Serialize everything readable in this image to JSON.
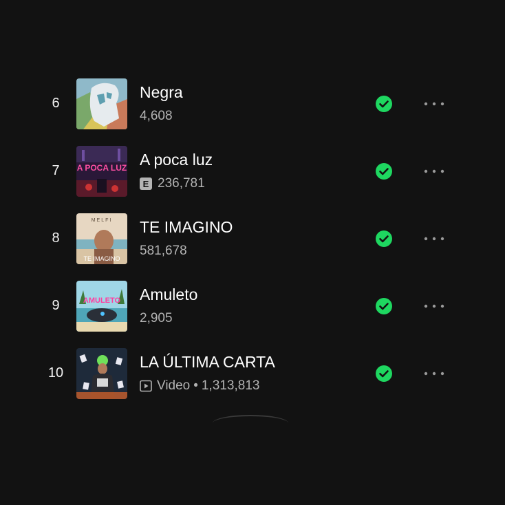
{
  "tracks": [
    {
      "rank": "6",
      "title": "Negra",
      "plays": "4,608",
      "explicit": false,
      "video": false,
      "saved": true,
      "artwork": "negra-artwork"
    },
    {
      "rank": "7",
      "title": "A poca luz",
      "plays": "236,781",
      "explicit": true,
      "explicit_label": "E",
      "video": false,
      "saved": true,
      "artwork": "a-poca-luz-artwork",
      "artwork_text": "A POCA LUZ"
    },
    {
      "rank": "8",
      "title": "TE IMAGINO",
      "plays": "581,678",
      "explicit": false,
      "video": false,
      "saved": true,
      "artwork": "te-imagino-artwork",
      "artwork_text_top": "MELFI",
      "artwork_text_bottom": "TE IMAGINO"
    },
    {
      "rank": "9",
      "title": "Amuleto",
      "plays": "2,905",
      "explicit": false,
      "video": false,
      "saved": true,
      "artwork": "amuleto-artwork",
      "artwork_text": "AMULETO"
    },
    {
      "rank": "10",
      "title": "LA ÚLTIMA CARTA",
      "plays": "1,313,813",
      "explicit": false,
      "video": true,
      "video_label": "Video",
      "separator": "•",
      "saved": true,
      "artwork": "la-ultima-carta-artwork"
    }
  ],
  "colors": {
    "background": "#121212",
    "accent": "#1ed760",
    "primary_text": "#ffffff",
    "secondary_text": "#b3b3b3"
  },
  "icons": {
    "saved": "check-circle-icon",
    "more": "more-dots-icon",
    "video": "play-square-icon"
  }
}
